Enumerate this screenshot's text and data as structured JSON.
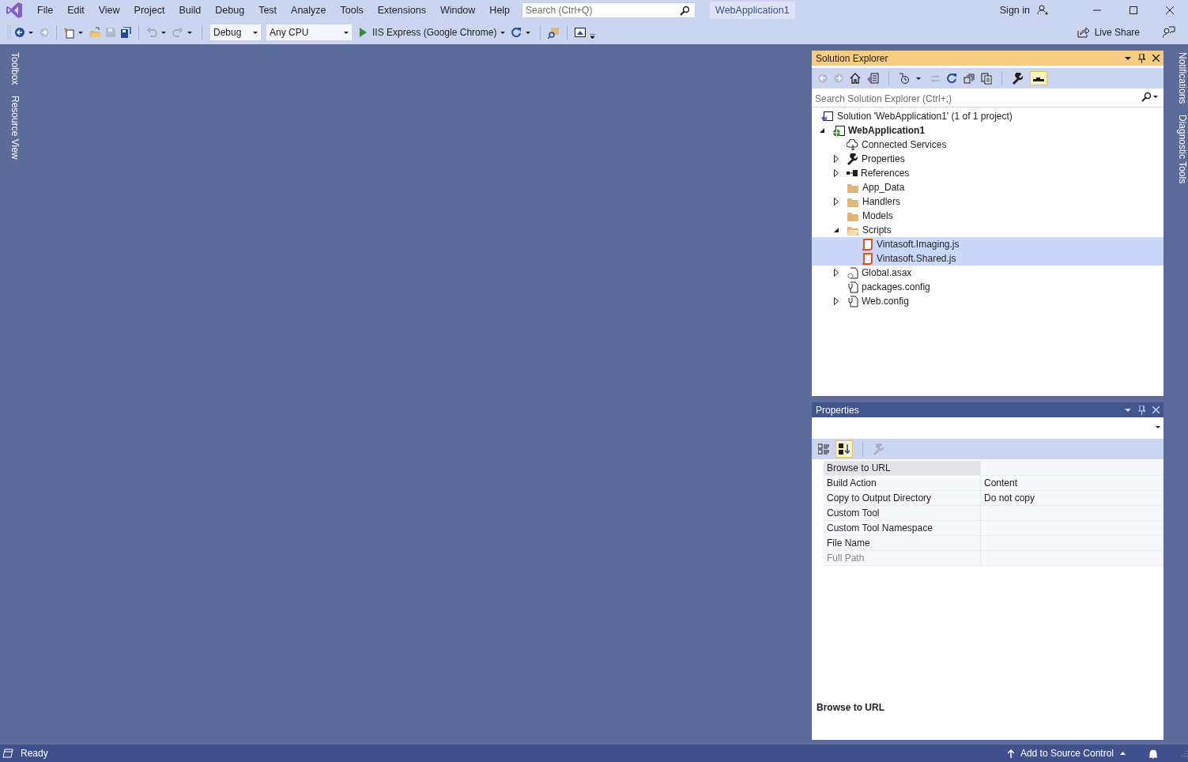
{
  "menu_bar": {
    "items": [
      "File",
      "Edit",
      "View",
      "Project",
      "Build",
      "Debug",
      "Test",
      "Analyze",
      "Tools",
      "Extensions",
      "Window",
      "Help"
    ]
  },
  "search": {
    "placeholder": "Search (Ctrl+Q)"
  },
  "solution_name": "WebApplication1",
  "account": {
    "label": "Sign in"
  },
  "toolbar": {
    "configuration": "Debug",
    "platform": "Any CPU",
    "run_target": "IIS Express (Google Chrome)",
    "live_share": "Live Share"
  },
  "left_tabs": [
    "Toolbox",
    "Resource View"
  ],
  "right_tabs": [
    "Notifications",
    "Diagnostic Tools"
  ],
  "solution_explorer": {
    "title": "Solution Explorer",
    "active": true,
    "search_placeholder": "Search Solution Explorer (Ctrl+;)",
    "tree": [
      {
        "label": "Solution 'WebApplication1' (1 of 1 project)",
        "kind": "solution",
        "selected": false,
        "children": [
          {
            "label": "WebApplication1",
            "kind": "web-project",
            "expanded": true,
            "selected": false,
            "bold": true,
            "children": [
              {
                "label": "Connected Services",
                "kind": "cloud",
                "selected": false
              },
              {
                "label": "Properties",
                "kind": "wrench",
                "expanded": false,
                "selected": false
              },
              {
                "label": "References",
                "kind": "references",
                "expanded": false,
                "selected": false
              },
              {
                "label": "App_Data",
                "kind": "folder",
                "selected": false
              },
              {
                "label": "Handlers",
                "kind": "folder",
                "expanded": false,
                "selected": false
              },
              {
                "label": "Models",
                "kind": "folder",
                "selected": false
              },
              {
                "label": "Scripts",
                "kind": "folder-open",
                "expanded": true,
                "selected": false,
                "children": [
                  {
                    "label": "Vintasoft.Imaging.js",
                    "kind": "js",
                    "selected": true
                  },
                  {
                    "label": "Vintasoft.Shared.js",
                    "kind": "js",
                    "selected": true
                  }
                ]
              },
              {
                "label": "Global.asax",
                "kind": "gear-file",
                "expanded": false,
                "selected": false
              },
              {
                "label": "packages.config",
                "kind": "config",
                "selected": false
              },
              {
                "label": "Web.config",
                "kind": "config",
                "expanded": false,
                "selected": false
              }
            ]
          }
        ]
      }
    ]
  },
  "properties": {
    "title": "Properties",
    "active": false,
    "alphabetical": true,
    "rows": [
      {
        "name": "Browse to URL",
        "selected": true,
        "disabled": false
      },
      {
        "name": "Build Action",
        "value": "Content",
        "selected": false,
        "disabled": false
      },
      {
        "name": "Copy to Output Directory",
        "value": "Do not copy",
        "selected": false,
        "disabled": false
      },
      {
        "name": "Custom Tool",
        "selected": false,
        "disabled": false
      },
      {
        "name": "Custom Tool Namespace",
        "selected": false,
        "disabled": false
      },
      {
        "name": "File Name",
        "selected": false,
        "disabled": false
      },
      {
        "name": "Full Path",
        "selected": false,
        "disabled": true
      }
    ],
    "description_title": "Browse to URL"
  },
  "status_bar": {
    "text": "Ready",
    "source_control": "Add to Source Control"
  }
}
